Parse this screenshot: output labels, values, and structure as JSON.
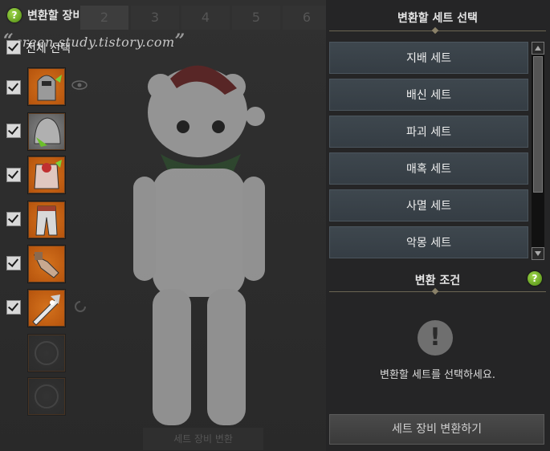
{
  "left_panel": {
    "title": "변환할 장비 선택",
    "tabs": [
      "2",
      "3",
      "4",
      "5",
      "6"
    ],
    "watermark": "green-study.tistory.com",
    "select_all_label": "전체 선택",
    "slots": [
      {
        "icon": "helmet-icon",
        "checked": true
      },
      {
        "icon": "hood-icon",
        "checked": true
      },
      {
        "icon": "armor-icon",
        "checked": true
      },
      {
        "icon": "pants-icon",
        "checked": true
      },
      {
        "icon": "gloves-icon",
        "checked": true
      },
      {
        "icon": "weapon-icon",
        "checked": true
      }
    ],
    "bottom_button": "세트 장비 변환"
  },
  "right_panel": {
    "set_header": "변환할 세트 선택",
    "sets": [
      "지배 세트",
      "배신 세트",
      "파괴 세트",
      "매혹 세트",
      "사멸 세트",
      "악몽 세트"
    ],
    "condition_header": "변환 조건",
    "alert_symbol": "!",
    "message": "변환할 세트를 선택하세요.",
    "convert_button": "세트 장비 변환하기"
  },
  "colors": {
    "accent_green": "#6fb22a",
    "slot_orange": "#c5621a",
    "set_button": "#3a434a"
  }
}
